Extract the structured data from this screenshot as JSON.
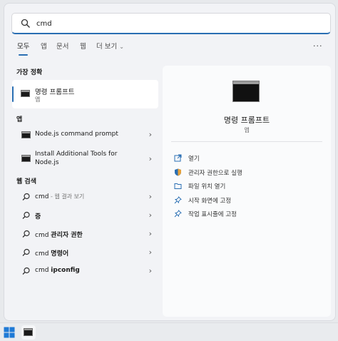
{
  "search": {
    "value": "cmd",
    "placeholder": ""
  },
  "tabs": [
    {
      "label": "모두"
    },
    {
      "label": "앱"
    },
    {
      "label": "문서"
    },
    {
      "label": "웹"
    },
    {
      "label": "더 보기"
    }
  ],
  "more_menu": "···",
  "best_match": {
    "heading": "가장 정확",
    "title": "명령 프롬프트",
    "subtitle": "앱"
  },
  "apps": {
    "heading": "앱",
    "items": [
      {
        "label": "Node.js command prompt"
      },
      {
        "label_line1": "Install Additional Tools for",
        "label_line2": "Node.js"
      }
    ]
  },
  "web_search": {
    "heading": "웹 검색",
    "items": [
      {
        "prefix": "cmd",
        "suffix": " - 웹 결과 보기"
      },
      {
        "bold": "증"
      },
      {
        "prefix": "cmd ",
        "bold": "관리자 권한"
      },
      {
        "prefix": "cmd ",
        "bold": "명령어"
      },
      {
        "prefix": "cmd ",
        "bold": "ipconfig"
      }
    ]
  },
  "detail": {
    "app_name": "명령 프롬프트",
    "app_kind": "앱",
    "actions": [
      {
        "label": "열기",
        "icon": "open-icon"
      },
      {
        "label": "관리자 권한으로 실행",
        "icon": "shield-icon"
      },
      {
        "label": "파일 위치 열기",
        "icon": "folder-icon"
      },
      {
        "label": "시작 화면에 고정",
        "icon": "pin-icon"
      },
      {
        "label": "작업 표시줄에 고정",
        "icon": "pin-icon"
      }
    ]
  },
  "colors": {
    "accent": "#2a6fb3",
    "panel": "#f2f3f6"
  }
}
